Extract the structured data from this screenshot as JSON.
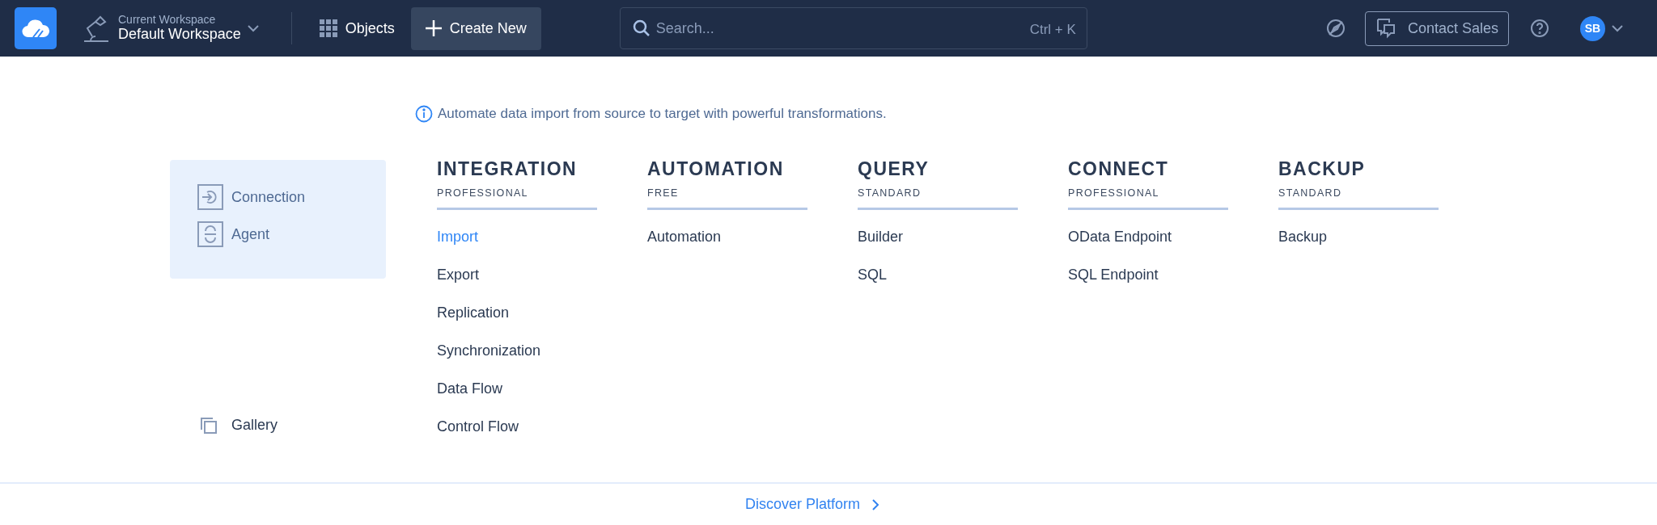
{
  "navbar": {
    "workspace": {
      "caption": "Current Workspace",
      "name": "Default Workspace"
    },
    "objects_label": "Objects",
    "create_label": "Create New",
    "search": {
      "placeholder": "Search...",
      "shortcut": "Ctrl + K"
    },
    "contact_label": "Contact Sales",
    "avatar_initials": "SB"
  },
  "info_text": "Automate data import from source to target with powerful transformations.",
  "side_panel": {
    "items": [
      {
        "label": "Connection",
        "kind": "connection"
      },
      {
        "label": "Agent",
        "kind": "agent"
      }
    ]
  },
  "gallery_label": "Gallery",
  "columns": [
    {
      "title": "INTEGRATION",
      "edition": "PROFESSIONAL",
      "items": [
        {
          "label": "Import",
          "highlighted": true
        },
        {
          "label": "Export",
          "highlighted": false
        },
        {
          "label": "Replication",
          "highlighted": false
        },
        {
          "label": "Synchronization",
          "highlighted": false
        },
        {
          "label": "Data Flow",
          "highlighted": false
        },
        {
          "label": "Control Flow",
          "highlighted": false
        }
      ]
    },
    {
      "title": "AUTOMATION",
      "edition": "FREE",
      "items": [
        {
          "label": "Automation",
          "highlighted": false
        }
      ]
    },
    {
      "title": "QUERY",
      "edition": "STANDARD",
      "items": [
        {
          "label": "Builder",
          "highlighted": false
        },
        {
          "label": "SQL",
          "highlighted": false
        }
      ]
    },
    {
      "title": "CONNECT",
      "edition": "PROFESSIONAL",
      "items": [
        {
          "label": "OData Endpoint",
          "highlighted": false
        },
        {
          "label": "SQL Endpoint",
          "highlighted": false
        }
      ]
    },
    {
      "title": "BACKUP",
      "edition": "STANDARD",
      "items": [
        {
          "label": "Backup",
          "highlighted": false
        }
      ]
    }
  ],
  "footer_link": "Discover Platform"
}
